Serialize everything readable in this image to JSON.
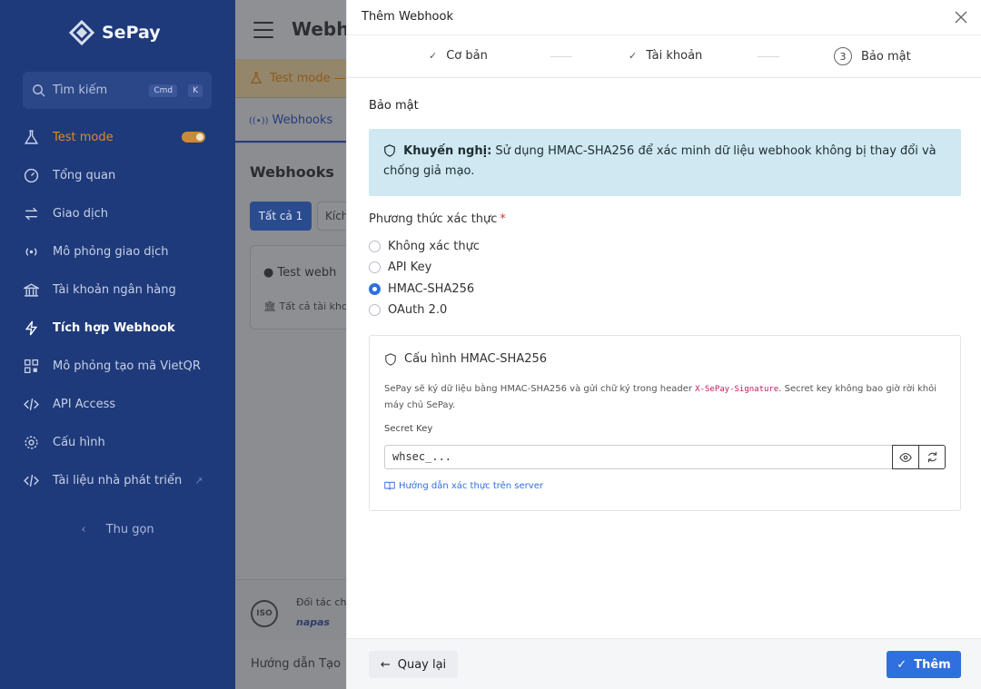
{
  "sidebar": {
    "brand": "SePay",
    "search": {
      "placeholder": "Tìm kiếm",
      "kbd1": "Cmd",
      "kbd2": "K"
    },
    "items": [
      {
        "label": "Test mode",
        "icon": "flask-icon"
      },
      {
        "label": "Tổng quan",
        "icon": "gauge-icon"
      },
      {
        "label": "Giao dịch",
        "icon": "swap-icon"
      },
      {
        "label": "Mô phỏng giao dịch",
        "icon": "broadcast-icon"
      },
      {
        "label": "Tài khoản ngân hàng",
        "icon": "bank-icon"
      },
      {
        "label": "Tích hợp Webhook",
        "icon": "bolt-icon"
      },
      {
        "label": "Mô phỏng tạo mã VietQR",
        "icon": "qr-icon"
      },
      {
        "label": "API Access",
        "icon": "code-icon"
      },
      {
        "label": "Cấu hình",
        "icon": "gear-icon"
      },
      {
        "label": "Tài liệu nhà phát triển",
        "icon": "code-icon"
      }
    ],
    "collapse": "Thu gọn"
  },
  "background": {
    "title": "Webho",
    "banner": "Test mode —",
    "tab": "Webhooks",
    "page_title": "Webhooks",
    "filter_all": "Tất cả 1",
    "filter_other": "Kích",
    "card_title": "Test webh",
    "card_sub": "Tất cả tài kho",
    "partner": "Đối tác ch",
    "partner_logo": "napas",
    "iso": "ISO",
    "footer": "Hướng dẫn   Tạo"
  },
  "modal": {
    "title": "Thêm Webhook",
    "steps": [
      {
        "label": "Cơ bản"
      },
      {
        "label": "Tài khoản"
      },
      {
        "number": "3",
        "label": "Bảo mật"
      }
    ],
    "section_title": "Bảo mật",
    "alert": {
      "bold": "Khuyến nghị:",
      "text": " Sử dụng HMAC-SHA256 để xác minh dữ liệu webhook không bị thay đổi và chống giả mạo."
    },
    "auth_label": "Phương thức xác thực",
    "required_mark": "*",
    "options": [
      "Không xác thực",
      "API Key",
      "HMAC-SHA256",
      "OAuth 2.0"
    ],
    "selected": "HMAC-SHA256",
    "config": {
      "title": "Cấu hình HMAC-SHA256",
      "desc_before": "SePay sẽ ký dữ liệu bằng HMAC-SHA256 và gửi chữ ký trong header ",
      "desc_code": "X-SePay-Signature",
      "desc_after": ". Secret key không bao giờ rời khỏi máy chủ SePay.",
      "secret_label": "Secret Key",
      "secret_value": "whsec_...",
      "guide": "Hướng dẫn xác thực trên server"
    },
    "back": "Quay lại",
    "submit": "Thêm"
  },
  "colors": {
    "sidebar": "#1f3a7a",
    "accent": "#2f6fde",
    "alert_bg": "#cfe8f1"
  }
}
